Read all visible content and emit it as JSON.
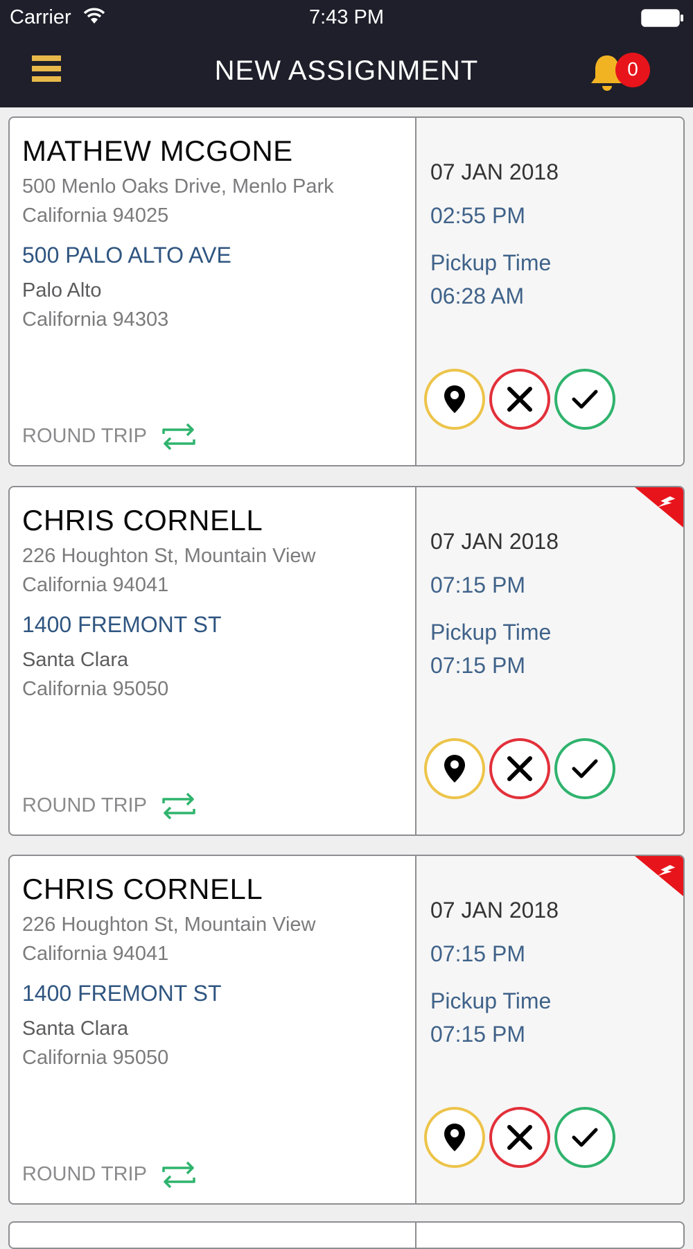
{
  "status_bar": {
    "carrier": "Carrier",
    "time": "7:43 PM"
  },
  "header": {
    "title": "NEW ASSIGNMENT",
    "notification_count": "0"
  },
  "colors": {
    "header_bg": "#1f1f2b",
    "menu_icon": "#e8b94a",
    "bell_icon": "#f2b323",
    "badge": "#e8141b",
    "locate_ring": "#edc44a",
    "reject_ring": "#e2303a",
    "accept_ring": "#2fb36d",
    "urgent_flag": "#e8141b",
    "link_blue": "#2f5580"
  },
  "assignments": [
    {
      "name": "MATHEW MCGONE",
      "pickup_address_line1": "500 Menlo Oaks Drive, Menlo Park",
      "pickup_address_line2": "California 94025",
      "dest_street": "500 PALO ALTO AVE",
      "dest_city": "Palo Alto",
      "dest_state_zip": "California 94303",
      "trip_type": "ROUND TRIP",
      "date": "07 JAN 2018",
      "time": "02:55 PM",
      "pickup_label": "Pickup Time",
      "pickup_time": "06:28 AM",
      "urgent": false,
      "actions": [
        "location-pin-icon",
        "close-icon",
        "check-icon"
      ]
    },
    {
      "name": "CHRIS CORNELL",
      "pickup_address_line1": "226 Houghton St, Mountain View",
      "pickup_address_line2": "California 94041",
      "dest_street": "1400 FREMONT ST",
      "dest_city": "Santa Clara",
      "dest_state_zip": "California 95050",
      "trip_type": "ROUND TRIP",
      "date": "07 JAN 2018",
      "time": "07:15 PM",
      "pickup_label": "Pickup Time",
      "pickup_time": "07:15 PM",
      "urgent": true,
      "actions": [
        "location-pin-icon",
        "close-icon",
        "check-icon"
      ]
    },
    {
      "name": "CHRIS CORNELL",
      "pickup_address_line1": "226 Houghton St, Mountain View",
      "pickup_address_line2": "California 94041",
      "dest_street": "1400 FREMONT ST",
      "dest_city": "Santa Clara",
      "dest_state_zip": "California 95050",
      "trip_type": "ROUND TRIP",
      "date": "07 JAN 2018",
      "time": "07:15 PM",
      "pickup_label": "Pickup Time",
      "pickup_time": "07:15 PM",
      "urgent": true,
      "actions": [
        "location-pin-icon",
        "close-icon",
        "check-icon"
      ]
    }
  ]
}
